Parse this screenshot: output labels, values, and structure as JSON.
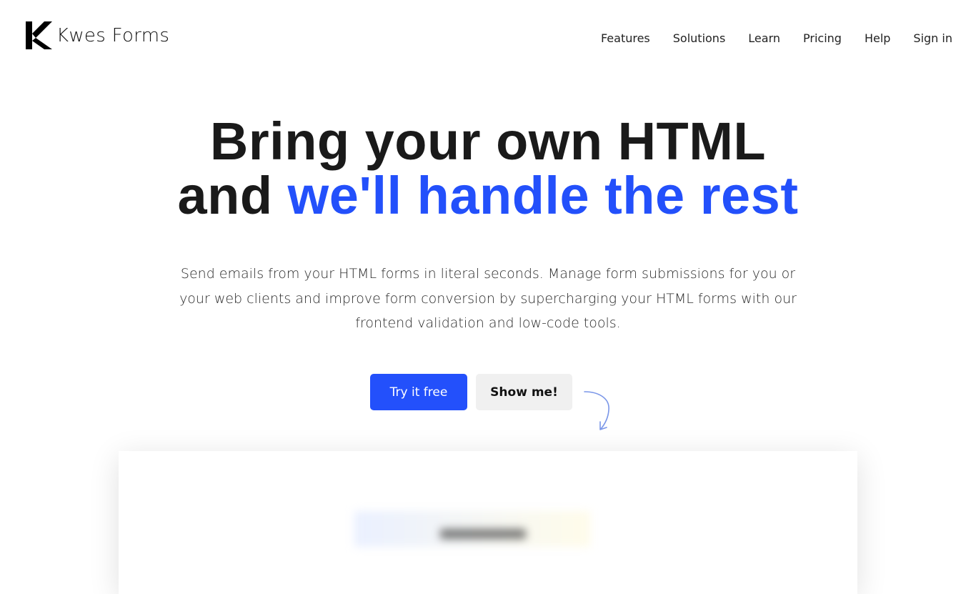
{
  "brand": {
    "name": "Kwes Forms",
    "logo_icon": "kwes-k-logo-icon"
  },
  "nav": {
    "items": [
      {
        "label": "Features"
      },
      {
        "label": "Solutions"
      },
      {
        "label": "Learn"
      },
      {
        "label": "Pricing"
      },
      {
        "label": "Help"
      },
      {
        "label": "Sign in"
      }
    ]
  },
  "hero": {
    "title_line1": "Bring your own HTML",
    "title_line2_prefix": "and ",
    "title_line2_accent": "we'll handle the rest",
    "subtitle": "Send emails from your HTML forms in literal seconds. Manage form submissions for you or your web clients and improve form conversion by supercharging your HTML forms with our frontend validation and low-code tools."
  },
  "cta": {
    "primary_label": "Try it free",
    "secondary_label": "Show me!",
    "arrow_icon": "curved-arrow-down-icon"
  },
  "colors": {
    "accent": "#2350fb",
    "text": "#1a1a1a",
    "secondary_button_bg": "#f0f0f0"
  }
}
